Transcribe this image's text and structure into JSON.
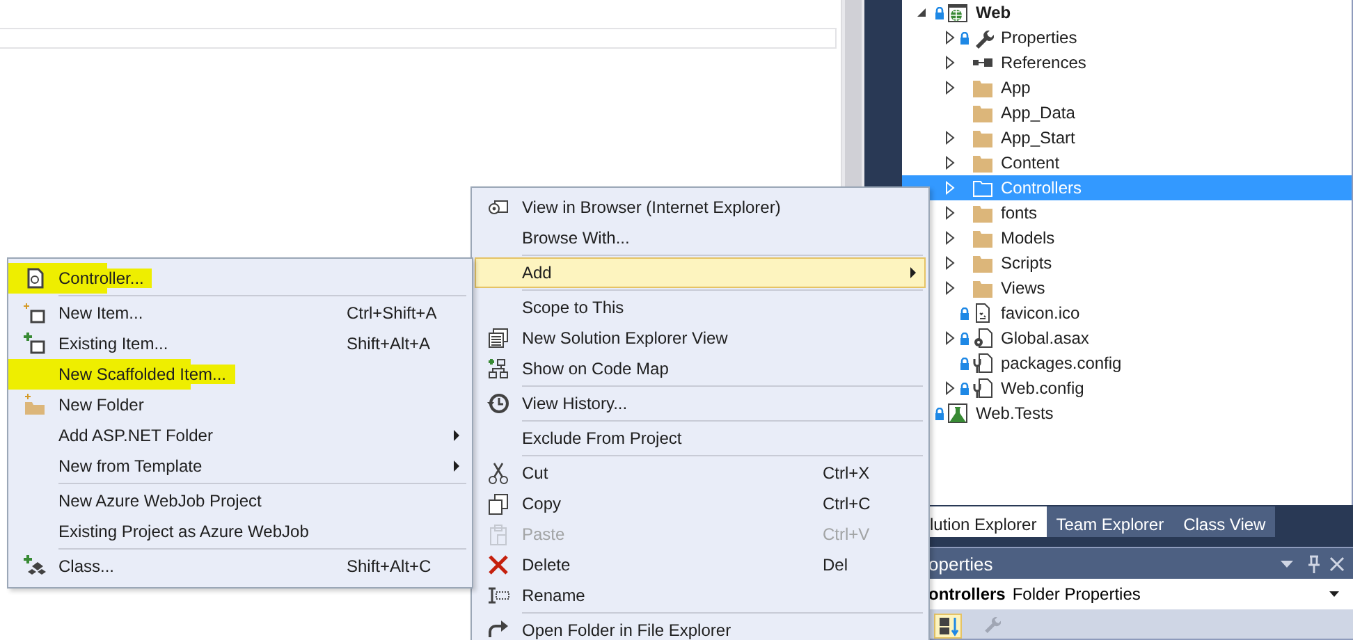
{
  "solution_explorer": {
    "tree": [
      {
        "label": "Web",
        "kind": "project",
        "locked": true,
        "expandable": true,
        "expanded": true,
        "selected": false,
        "children": [
          {
            "label": "Properties",
            "kind": "properties",
            "locked": true,
            "expandable": true,
            "expanded": false,
            "selected": false
          },
          {
            "label": "References",
            "kind": "references",
            "locked": false,
            "expandable": true,
            "expanded": false,
            "selected": false
          },
          {
            "label": "App",
            "kind": "folder",
            "locked": false,
            "expandable": true,
            "expanded": false,
            "selected": false
          },
          {
            "label": "App_Data",
            "kind": "folder",
            "locked": false,
            "expandable": false,
            "selected": false
          },
          {
            "label": "App_Start",
            "kind": "folder",
            "locked": false,
            "expandable": true,
            "expanded": false,
            "selected": false
          },
          {
            "label": "Content",
            "kind": "folder",
            "locked": false,
            "expandable": true,
            "expanded": false,
            "selected": false
          },
          {
            "label": "Controllers",
            "kind": "folder",
            "locked": false,
            "expandable": true,
            "expanded": false,
            "selected": true
          },
          {
            "label": "fonts",
            "kind": "folder",
            "locked": false,
            "expandable": true,
            "expanded": false,
            "selected": false
          },
          {
            "label": "Models",
            "kind": "folder",
            "locked": false,
            "expandable": true,
            "expanded": false,
            "selected": false
          },
          {
            "label": "Scripts",
            "kind": "folder",
            "locked": false,
            "expandable": true,
            "expanded": false,
            "selected": false
          },
          {
            "label": "Views",
            "kind": "folder",
            "locked": false,
            "expandable": true,
            "expanded": false,
            "selected": false
          },
          {
            "label": "favicon.ico",
            "kind": "image-file",
            "locked": true,
            "expandable": false,
            "selected": false
          },
          {
            "label": "Global.asax",
            "kind": "code-file",
            "locked": true,
            "expandable": true,
            "expanded": false,
            "selected": false
          },
          {
            "label": "packages.config",
            "kind": "config-file",
            "locked": true,
            "expandable": false,
            "selected": false
          },
          {
            "label": "Web.config",
            "kind": "config-file",
            "locked": true,
            "expandable": true,
            "expanded": false,
            "selected": false
          }
        ]
      },
      {
        "label": "Web.Tests",
        "kind": "test-project",
        "locked": true,
        "expandable": false,
        "selected": false
      }
    ]
  },
  "tool_tabs": [
    {
      "label": "lution Explorer",
      "selected": true
    },
    {
      "label": "Team Explorer",
      "selected": false
    },
    {
      "label": "Class View",
      "selected": false
    }
  ],
  "properties": {
    "title": "operties",
    "object_name": "ontrollers",
    "object_type": "Folder Properties"
  },
  "context_menu": {
    "groups": [
      [
        {
          "label": "View in Browser (Internet Explorer)",
          "submenu": false,
          "selected": false,
          "disabled": false
        },
        {
          "label": "Browse With...",
          "submenu": false,
          "selected": false,
          "disabled": false
        }
      ],
      [
        {
          "label": "Add",
          "submenu": true,
          "selected": true,
          "disabled": false
        }
      ],
      [
        {
          "label": "Scope to This",
          "submenu": false,
          "selected": false,
          "disabled": false
        },
        {
          "label": "New Solution Explorer View",
          "submenu": false,
          "selected": false,
          "disabled": false
        },
        {
          "label": "Show on Code Map",
          "submenu": false,
          "selected": false,
          "disabled": false
        }
      ],
      [
        {
          "label": "View History...",
          "submenu": false,
          "selected": false,
          "disabled": false
        }
      ],
      [
        {
          "label": "Exclude From Project",
          "submenu": false,
          "selected": false,
          "disabled": false
        }
      ],
      [
        {
          "label": "Cut",
          "shortcut": "Ctrl+X",
          "submenu": false,
          "selected": false,
          "disabled": false
        },
        {
          "label": "Copy",
          "shortcut": "Ctrl+C",
          "submenu": false,
          "selected": false,
          "disabled": false
        },
        {
          "label": "Paste",
          "shortcut": "Ctrl+V",
          "submenu": false,
          "selected": false,
          "disabled": true
        },
        {
          "label": "Delete",
          "shortcut": "Del",
          "submenu": false,
          "selected": false,
          "disabled": false
        },
        {
          "label": "Rename",
          "submenu": false,
          "selected": false,
          "disabled": false
        }
      ],
      [
        {
          "label": "Open Folder in File Explorer",
          "submenu": false,
          "selected": false,
          "disabled": false
        }
      ]
    ]
  },
  "add_submenu": {
    "groups": [
      [
        {
          "label": "Controller...",
          "submenu": false,
          "marked": true
        }
      ],
      [
        {
          "label": "New Item...",
          "shortcut": "Ctrl+Shift+A",
          "submenu": false,
          "marked": false
        },
        {
          "label": "Existing Item...",
          "shortcut": "Shift+Alt+A",
          "submenu": false,
          "marked": false
        },
        {
          "label": "New Scaffolded Item...",
          "submenu": false,
          "marked": true
        },
        {
          "label": "New Folder",
          "submenu": false,
          "marked": false
        },
        {
          "label": "Add ASP.NET Folder",
          "submenu": true,
          "marked": false
        },
        {
          "label": "New from Template",
          "submenu": true,
          "marked": false
        }
      ],
      [
        {
          "label": "New Azure WebJob Project",
          "submenu": false,
          "marked": false
        },
        {
          "label": "Existing Project as Azure WebJob",
          "submenu": false,
          "marked": false
        }
      ],
      [
        {
          "label": "Class...",
          "shortcut": "Shift+Alt+C",
          "submenu": false,
          "marked": false
        }
      ]
    ]
  }
}
